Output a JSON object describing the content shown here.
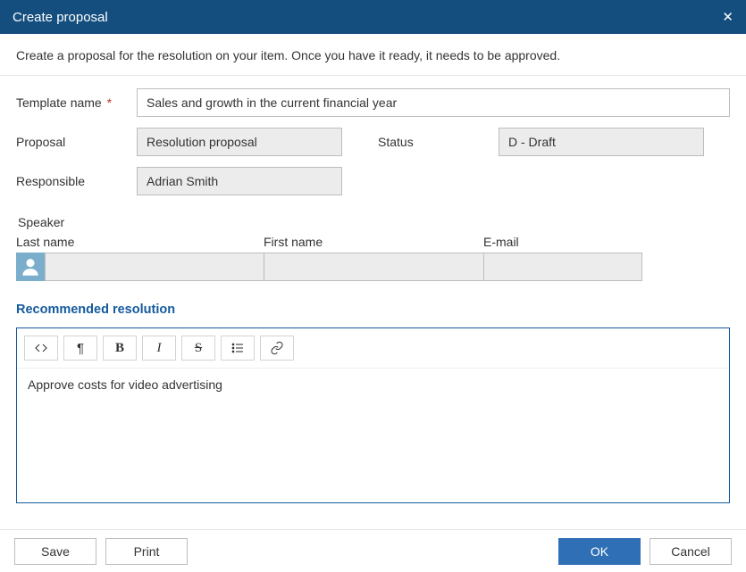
{
  "header": {
    "title": "Create proposal"
  },
  "intro": "Create a proposal for the resolution on your item. Once you have it ready, it needs to be approved.",
  "labels": {
    "template": "Template name",
    "proposal": "Proposal",
    "status": "Status",
    "responsible": "Responsible",
    "speaker": "Speaker",
    "lastname": "Last name",
    "firstname": "First name",
    "email": "E-mail"
  },
  "fields": {
    "template": "Sales and growth in the current financial year",
    "proposal": "Resolution proposal",
    "status": "D - Draft",
    "responsible": "Adrian Smith"
  },
  "speaker": {
    "lastname": "",
    "firstname": "",
    "email": ""
  },
  "section": {
    "recommended": "Recommended resolution"
  },
  "editor": {
    "body": "Approve costs for video advertising"
  },
  "footer": {
    "save": "Save",
    "print": "Print",
    "ok": "OK",
    "cancel": "Cancel"
  }
}
